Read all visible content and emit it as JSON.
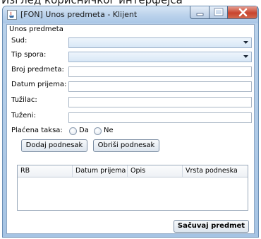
{
  "page_top_text": "Изглед корисничког интерфејса",
  "window": {
    "title": "[FON] Unos predmeta - Klijent"
  },
  "form": {
    "panel_title": "Unos predmeta",
    "sud_label": "Sud:",
    "sud_value": "",
    "tip_spora_label": "Tip spora:",
    "tip_spora_value": "",
    "broj_predmeta_label": "Broj predmeta:",
    "broj_predmeta_value": "",
    "datum_prijema_label": "Datum prijema:",
    "datum_prijema_value": "",
    "tuzilac_label": "Tužilac:",
    "tuzilac_value": "",
    "tuzeni_label": "Tuženi:",
    "tuzeni_value": "",
    "placena_taksa_label": "Plaćena taksa:",
    "radio_da": "Da",
    "radio_ne": "Ne"
  },
  "buttons": {
    "dodaj": "Dodaj podnesak",
    "obrisi": "Obriši podnesak",
    "sacuvaj": "Sačuvaj predmet"
  },
  "table": {
    "columns": [
      "RB",
      "Datum prijema",
      "Opis",
      "Vrsta podneska"
    ],
    "rows": []
  },
  "icons": {
    "app": "java-app-icon",
    "minimize": "minimize-icon",
    "maximize": "maximize-icon",
    "close": "close-icon",
    "dropdown": "chevron-down-icon"
  },
  "colors": {
    "close_button": "#c7442e",
    "titlebar": "#bcd3ec"
  }
}
